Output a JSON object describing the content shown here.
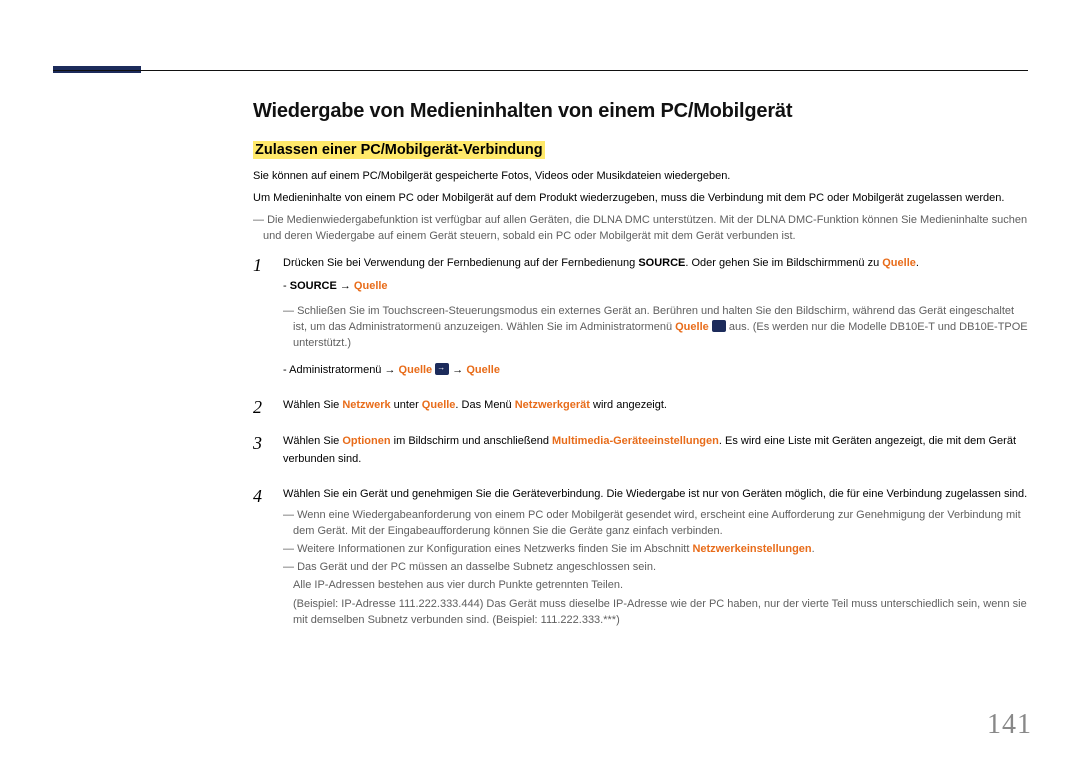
{
  "title": "Wiedergabe von Medieninhalten von einem PC/Mobilgerät",
  "subtitle": "Zulassen einer PC/Mobilgerät-Verbindung",
  "intro1": "Sie können auf einem PC/Mobilgerät gespeicherte Fotos, Videos oder Musikdateien wiedergeben.",
  "intro2": "Um Medieninhalte von einem PC oder Mobilgerät auf dem Produkt wiederzugeben, muss die Verbindung mit dem PC oder Mobilgerät zugelassen werden.",
  "note_dlna": "Die Medienwiedergabefunktion ist verfügbar auf allen Geräten, die DLNA DMC unterstützen. Mit der DLNA DMC-Funktion können Sie Medieninhalte suchen und deren Wiedergabe auf einem Gerät steuern, sobald ein PC oder Mobilgerät mit dem Gerät verbunden ist.",
  "step1_a": "Drücken Sie bei Verwendung der Fernbedienung auf der Fernbedienung ",
  "step1_source": "SOURCE",
  "step1_b": ". Oder gehen Sie im Bildschirmmenü zu ",
  "step1_quelle": "Quelle",
  "step1_c": ".",
  "step1_sub1_dash": "- ",
  "step1_sub1_source": "SOURCE",
  "step1_sub1_arrow": " → ",
  "step1_sub1_quelle": "Quelle",
  "step1_touch_a": "Schließen Sie im Touchscreen-Steuerungsmodus ein externes Gerät an. Berühren und halten Sie den Bildschirm, während das Gerät eingeschaltet ist, um das Administratormenü anzuzeigen. Wählen Sie im Administratormenü ",
  "step1_touch_quelle": "Quelle",
  "step1_touch_b": " aus. (Es werden nur die Modelle DB10E-T und DB10E-TPOE unterstützt.)",
  "step1_admin_a": "- Administratormenü → ",
  "step1_admin_q1": "Quelle",
  "step1_admin_arrow2": " → ",
  "step1_admin_q2": "Quelle",
  "step2_a": "Wählen Sie ",
  "step2_netz": "Netzwerk",
  "step2_b": " unter ",
  "step2_quelle": "Quelle",
  "step2_c": ". Das Menü ",
  "step2_netzg": "Netzwerkgerät",
  "step2_d": " wird angezeigt.",
  "step3_a": "Wählen Sie ",
  "step3_opt": "Optionen",
  "step3_b": " im Bildschirm und anschließend ",
  "step3_mm": "Multimedia-Geräteeinstellungen",
  "step3_c": ". Es wird eine Liste mit Geräten angezeigt, die mit dem Gerät verbunden sind.",
  "step4": "Wählen Sie ein Gerät und genehmigen Sie die Geräteverbindung. Die Wiedergabe ist nur von Geräten möglich, die für eine Verbindung zugelassen sind.",
  "post_note1": "Wenn eine Wiedergabeanforderung von einem PC oder Mobilgerät gesendet wird, erscheint eine Aufforderung zur Genehmigung der Verbindung mit dem Gerät. Mit der Eingabeaufforderung können Sie die Geräte ganz einfach verbinden.",
  "post_note2_a": "Weitere Informationen zur Konfiguration eines Netzwerks finden Sie im Abschnitt ",
  "post_note2_link": "Netzwerkeinstellungen",
  "post_note2_b": ".",
  "post_note3": "Das Gerät und der PC müssen an dasselbe Subnetz angeschlossen sein.",
  "post_note3_sub1": "Alle IP-Adressen bestehen aus vier durch Punkte getrennten Teilen.",
  "post_note3_sub2": "(Beispiel: IP-Adresse 111.222.333.444) Das Gerät muss dieselbe IP-Adresse wie der PC haben, nur der vierte Teil muss unterschiedlich sein, wenn sie mit demselben Subnetz verbunden sind. (Beispiel: 111.222.333.***)",
  "page_number": "141"
}
